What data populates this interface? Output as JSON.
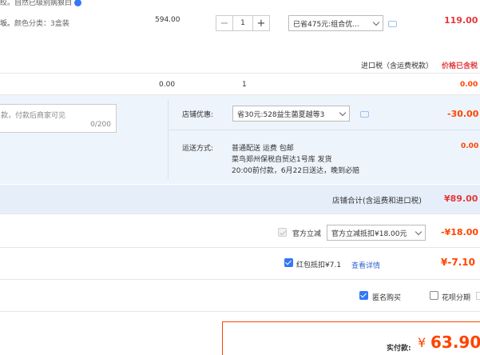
{
  "item": {
    "title_fragment": "绞。自然已级别病狠白",
    "spec_label": "颜色分类：",
    "spec_value": "3盒装",
    "unit_price": "594.00",
    "quantity": "1",
    "promo_select": "已省475元:组合优...",
    "subtotal": "119.00"
  },
  "tax_header": {
    "tax_label": "进口税（含运费税款）",
    "tax_note": "价格已含税"
  },
  "tax_row": {
    "tax_amount": "0.00",
    "tax_qty": "1",
    "tax_total": "0.00"
  },
  "message": {
    "placeholder": "款，付款后商家可见",
    "counter": "0/200"
  },
  "shop_discount": {
    "label": "店铺优惠:",
    "select": "省30元:528益生菌夏越等3",
    "amount": "-30.00"
  },
  "shipping": {
    "label": "运送方式:",
    "methods": "普通配送 运费 包邮",
    "warehouse": "菜鸟郑州保税自贸达1号库    发货",
    "eta": "20:00前付款，6月22日送达，晚到必赔",
    "amount": "0.00"
  },
  "shop_total": {
    "label": "店铺合计(含运费和进口税)",
    "value": "¥89.00"
  },
  "official": {
    "label": "官方立减",
    "select": "官方立减抵扣¥18.00元",
    "amount": "-¥18.00"
  },
  "hongbao": {
    "label": "红包抵扣¥7.1",
    "link": "查看详情",
    "amount": "¥-7.10"
  },
  "options": {
    "anonymous": "匿名购买",
    "huabei": "花呗分期"
  },
  "payment": {
    "label": "实付款:",
    "currency": "¥",
    "value": "63.90"
  },
  "colors": {
    "accent": "#ff4400",
    "band_bg": "#eef4fc",
    "link": "#3366cc"
  }
}
